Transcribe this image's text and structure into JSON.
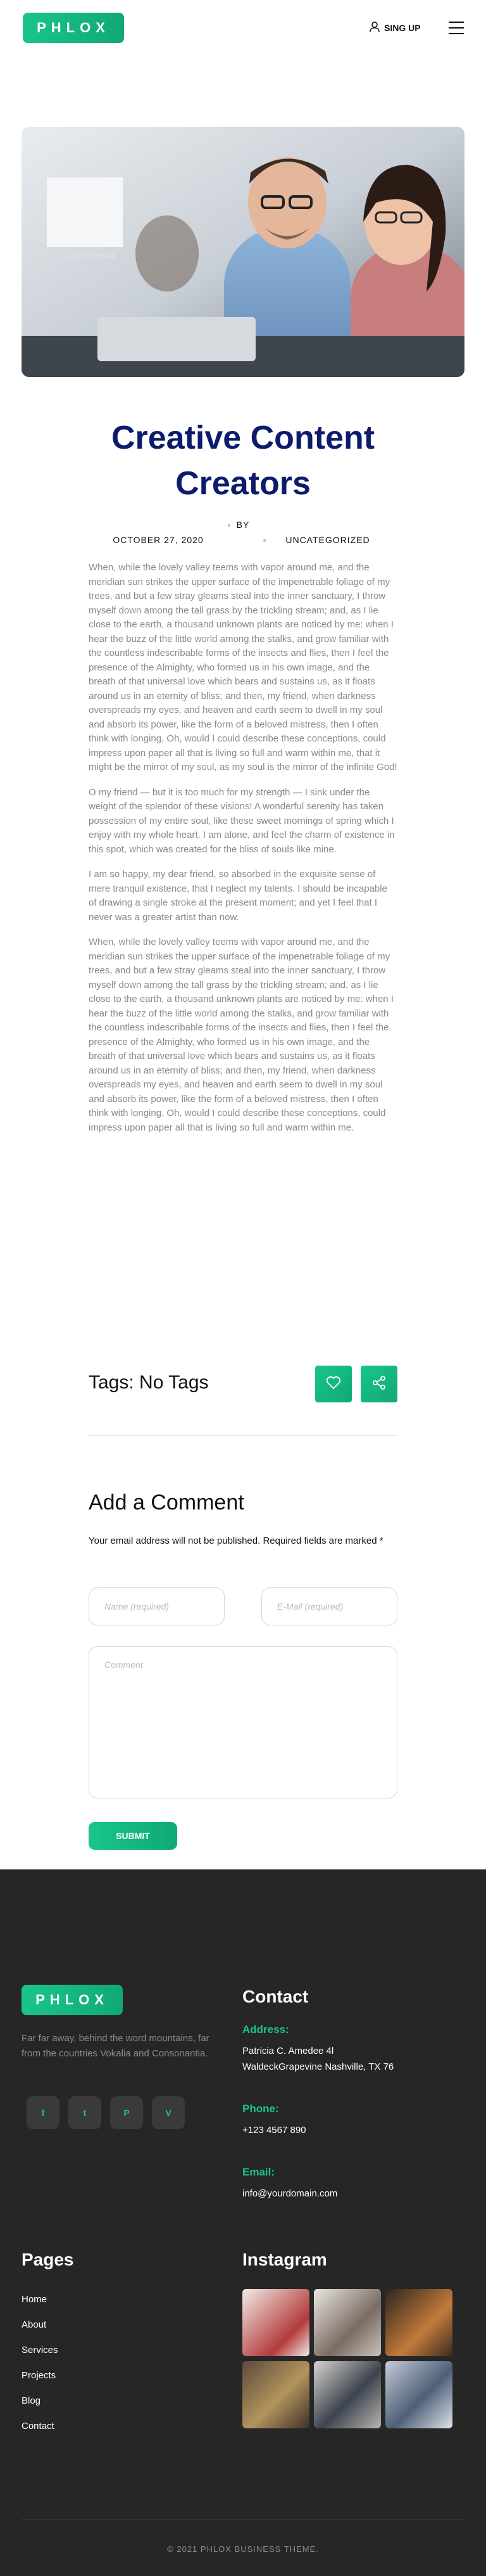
{
  "header": {
    "logo_text": "PHLOX",
    "signup_label": "SING UP",
    "user_icon": "user-icon",
    "menu_icon": "hamburger-menu-icon"
  },
  "post": {
    "title_line1": "Creative Content",
    "title_line2": "Creators",
    "by_label": "BY",
    "date": "OCTOBER 27, 2020",
    "category": "UNCATEGORIZED",
    "paragraphs": [
      "When, while the lovely valley teems with vapor around me, and the meridian sun strikes the upper surface of the impenetrable foliage of my trees, and but a few stray gleams steal into the inner sanctuary, I throw myself down among the tall grass by the trickling stream; and, as I lie close to the earth, a thousand unknown plants are noticed by me: when I hear the buzz of the little world among the stalks, and grow familiar with the countless indescribable forms of the insects and flies, then I feel the presence of the Almighty, who formed us in his own image, and the breath of that universal love which bears and sustains us, as it floats around us in an eternity of bliss; and then, my friend, when darkness overspreads my eyes, and heaven and earth seem to dwell in my soul and absorb its power, like the form of a beloved mistress, then I often think with longing, Oh, would I could describe these conceptions, could impress upon paper all that is living so full and warm within me, that it might be the mirror of my soul, as my soul is the mirror of the infinite God!",
      "O my friend — but it is too much for my strength — I sink under the weight of the splendor of these visions! A wonderful serenity has taken possession of my entire soul, like these sweet mornings of spring which I enjoy with my whole heart. I am alone, and feel the charm of existence in this spot, which was created for the bliss of souls like mine.",
      "I am so happy, my dear friend, so absorbed in the exquisite sense of mere tranquil existence, that I neglect my talents. I should be incapable of drawing a single stroke at the present moment; and yet I feel that I never was a greater artist than now.",
      "When, while the lovely valley teems with vapor around me, and the meridian sun strikes the upper surface of the impenetrable foliage of my trees, and but a few stray gleams steal into the inner sanctuary, I throw myself down among the tall grass by the trickling stream; and, as I lie close to the earth, a thousand unknown plants are noticed by me: when I hear the buzz of the little world among the stalks, and grow familiar with the countless indescribable forms of the insects and flies, then I feel the presence of the Almighty, who formed us in his own image, and the breath of that universal love which bears and sustains us, as it floats around us in an eternity of bliss; and then, my friend, when darkness overspreads my eyes, and heaven and earth seem to dwell in my soul and absorb its power, like the form of a beloved mistress, then I often think with longing, Oh, would I could describe these conceptions, could impress upon paper all that is living so full and warm within me."
    ],
    "tags_label": "Tags: No Tags",
    "like_icon": "heart-icon",
    "share_icon": "share-icon"
  },
  "comment": {
    "title": "Add a Comment",
    "note": "Your email address will not be published. Required fields are marked *",
    "name_placeholder": "Name (required)",
    "email_placeholder": "E-Mail (required)",
    "comment_placeholder": "Comment",
    "submit_label": "SUBMIT"
  },
  "footer": {
    "logo_text": "PHLOX",
    "about": "Far far away, behind the word mountains, far from the countries Vokalia and Consonantia.",
    "social": [
      "f",
      "t",
      "P",
      "V"
    ],
    "social_icons": [
      "facebook-icon",
      "twitter-icon",
      "pinterest-icon",
      "vimeo-icon"
    ],
    "contact_title": "Contact",
    "address_label": "Address:",
    "address_line1": "Patricia C. Amedee 4l",
    "address_line2": "WaldeckGrapevine Nashville, TX 76",
    "phone_label": "Phone:",
    "phone": "+123 4567 890",
    "email_label": "Email:",
    "email": "info@yourdomain.com",
    "pages_title": "Pages",
    "pages": [
      "Home",
      "About",
      "Services",
      "Projects",
      "Blog",
      "Contact"
    ],
    "instagram_title": "Instagram",
    "copyright": "© 2021 PHLOX BUSINESS THEME."
  },
  "colors": {
    "accent": "#19c58a",
    "title": "#0c1b6b",
    "footer_bg": "#262626"
  }
}
